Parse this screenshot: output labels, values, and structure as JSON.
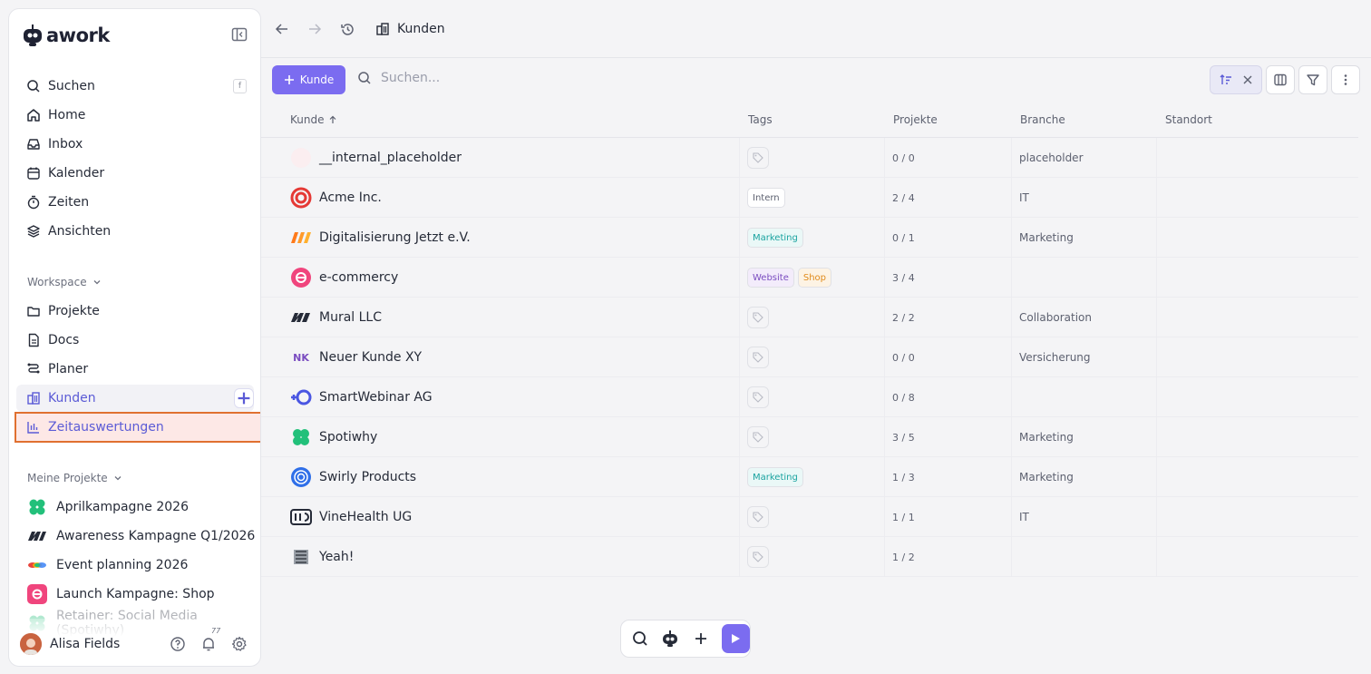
{
  "app": {
    "name": "awork"
  },
  "sidebar": {
    "nav": [
      {
        "label": "Suchen",
        "icon": "search-icon",
        "shortcut": "f"
      },
      {
        "label": "Home",
        "icon": "home-icon"
      },
      {
        "label": "Inbox",
        "icon": "inbox-icon"
      },
      {
        "label": "Kalender",
        "icon": "calendar-icon"
      },
      {
        "label": "Zeiten",
        "icon": "stopwatch-icon"
      },
      {
        "label": "Ansichten",
        "icon": "layers-icon"
      }
    ],
    "workspace_label": "Workspace",
    "workspace": [
      {
        "label": "Projekte",
        "icon": "folder-icon"
      },
      {
        "label": "Docs",
        "icon": "document-icon"
      },
      {
        "label": "Planer",
        "icon": "planner-icon"
      },
      {
        "label": "Kunden",
        "icon": "building-icon"
      },
      {
        "label": "Zeitauswertungen",
        "icon": "bar-chart-icon"
      }
    ],
    "projects_label": "Meine Projekte",
    "projects": [
      {
        "label": "Aprilkampagne 2026"
      },
      {
        "label": "Awareness Kampagne Q1/2026"
      },
      {
        "label": "Event planning 2026"
      },
      {
        "label": "Launch Kampagne: Shop"
      },
      {
        "label": "Retainer: Social Media (Spotiwhy)"
      }
    ],
    "user": {
      "name": "Alisa Fields",
      "notifications": "77"
    }
  },
  "topbar": {
    "breadcrumb": "Kunden"
  },
  "toolbar": {
    "add_label": "Kunde",
    "search_placeholder": "Suchen..."
  },
  "table": {
    "columns": [
      "Kunde",
      "Tags",
      "Projekte",
      "Branche",
      "Standort"
    ],
    "rows": [
      {
        "name": "__internal_placeholder",
        "tags": [],
        "projects": "0 / 0",
        "branch": "placeholder",
        "location": ""
      },
      {
        "name": "Acme Inc.",
        "tags": [
          {
            "label": "Intern",
            "color": "#5d6170",
            "bg": "#ffffff"
          }
        ],
        "projects": "2 / 4",
        "branch": "IT",
        "location": ""
      },
      {
        "name": "Digitalisierung Jetzt e.V.",
        "tags": [
          {
            "label": "Marketing",
            "color": "#1aa3a0",
            "bg": "#eaf8f7"
          }
        ],
        "projects": "0 / 1",
        "branch": "Marketing",
        "location": ""
      },
      {
        "name": "e-commercy",
        "tags": [
          {
            "label": "Website",
            "color": "#7a4cc0",
            "bg": "#f3ecfb"
          },
          {
            "label": "Shop",
            "color": "#e08a1a",
            "bg": "#fdf3e4"
          }
        ],
        "projects": "3 / 4",
        "branch": "",
        "location": ""
      },
      {
        "name": "Mural LLC",
        "tags": [],
        "projects": "2 / 2",
        "branch": "Collaboration",
        "location": ""
      },
      {
        "name": "Neuer Kunde XY",
        "initials": "NK",
        "tags": [],
        "projects": "0 / 0",
        "branch": "Versicherung",
        "location": ""
      },
      {
        "name": "SmartWebinar AG",
        "tags": [],
        "projects": "0 / 8",
        "branch": "",
        "location": ""
      },
      {
        "name": "Spotiwhy",
        "tags": [],
        "projects": "3 / 5",
        "branch": "Marketing",
        "location": ""
      },
      {
        "name": "Swirly Products",
        "tags": [
          {
            "label": "Marketing",
            "color": "#1aa3a0",
            "bg": "#eaf8f7"
          }
        ],
        "projects": "1 / 3",
        "branch": "Marketing",
        "location": ""
      },
      {
        "name": "VineHealth UG",
        "tags": [],
        "projects": "1 / 1",
        "branch": "IT",
        "location": ""
      },
      {
        "name": "Yeah!",
        "tags": [],
        "projects": "1 / 2",
        "branch": "",
        "location": ""
      }
    ]
  },
  "colors": {
    "accent": "#7b6cf0",
    "highlight_border": "#e07030",
    "highlight_bg": "#fde8e6"
  }
}
